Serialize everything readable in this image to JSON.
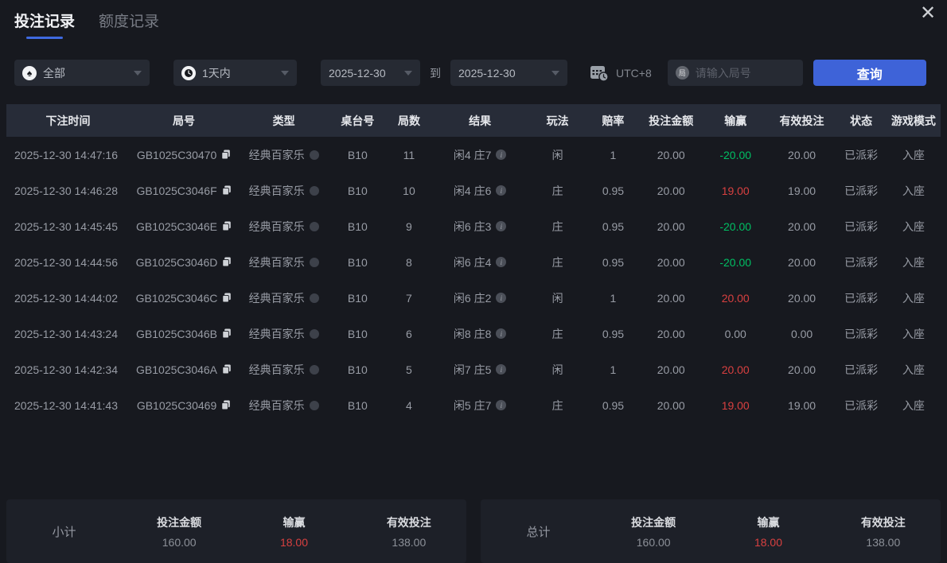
{
  "window": {
    "close_glyph": "✕"
  },
  "tabs": [
    {
      "label": "投注记录",
      "active": true
    },
    {
      "label": "额度记录",
      "active": false
    }
  ],
  "filters": {
    "game_type": {
      "value": "全部",
      "icon": "spade-icon",
      "spade_glyph": "♠"
    },
    "time_range": {
      "value": "1天内",
      "icon": "clock-icon"
    },
    "date_from": "2025-12-30",
    "to_label": "到",
    "date_to": "2025-12-30",
    "timezone": {
      "label": "UTC+8",
      "icon": "calendar-clock-icon"
    },
    "round_input": {
      "placeholder": "请输入局号",
      "badge": "局"
    },
    "query_button": "查询"
  },
  "table": {
    "columns": [
      "下注时间",
      "局号",
      "类型",
      "桌台号",
      "局数",
      "结果",
      "玩法",
      "赔率",
      "投注金额",
      "输赢",
      "有效投注",
      "状态",
      "游戏模式"
    ],
    "rows": [
      {
        "time": "2025-12-30 14:47:16",
        "round_id": "GB1025C30470",
        "type": "经典百家乐",
        "table_no": "B10",
        "round_no": "11",
        "result": "闲4 庄7",
        "play": "闲",
        "odds": "1",
        "bet": "20.00",
        "win_loss": "-20.00",
        "win_loss_color": "green",
        "valid_bet": "20.00",
        "status": "已派彩",
        "mode": "入座"
      },
      {
        "time": "2025-12-30 14:46:28",
        "round_id": "GB1025C3046F",
        "type": "经典百家乐",
        "table_no": "B10",
        "round_no": "10",
        "result": "闲4 庄6",
        "play": "庄",
        "odds": "0.95",
        "bet": "20.00",
        "win_loss": "19.00",
        "win_loss_color": "red",
        "valid_bet": "19.00",
        "status": "已派彩",
        "mode": "入座"
      },
      {
        "time": "2025-12-30 14:45:45",
        "round_id": "GB1025C3046E",
        "type": "经典百家乐",
        "table_no": "B10",
        "round_no": "9",
        "result": "闲6 庄3",
        "play": "庄",
        "odds": "0.95",
        "bet": "20.00",
        "win_loss": "-20.00",
        "win_loss_color": "green",
        "valid_bet": "20.00",
        "status": "已派彩",
        "mode": "入座"
      },
      {
        "time": "2025-12-30 14:44:56",
        "round_id": "GB1025C3046D",
        "type": "经典百家乐",
        "table_no": "B10",
        "round_no": "8",
        "result": "闲6 庄4",
        "play": "庄",
        "odds": "0.95",
        "bet": "20.00",
        "win_loss": "-20.00",
        "win_loss_color": "green",
        "valid_bet": "20.00",
        "status": "已派彩",
        "mode": "入座"
      },
      {
        "time": "2025-12-30 14:44:02",
        "round_id": "GB1025C3046C",
        "type": "经典百家乐",
        "table_no": "B10",
        "round_no": "7",
        "result": "闲6 庄2",
        "play": "闲",
        "odds": "1",
        "bet": "20.00",
        "win_loss": "20.00",
        "win_loss_color": "red",
        "valid_bet": "20.00",
        "status": "已派彩",
        "mode": "入座"
      },
      {
        "time": "2025-12-30 14:43:24",
        "round_id": "GB1025C3046B",
        "type": "经典百家乐",
        "table_no": "B10",
        "round_no": "6",
        "result": "闲8 庄8",
        "play": "庄",
        "odds": "0.95",
        "bet": "20.00",
        "win_loss": "0.00",
        "win_loss_color": "normal",
        "valid_bet": "0.00",
        "status": "已派彩",
        "mode": "入座"
      },
      {
        "time": "2025-12-30 14:42:34",
        "round_id": "GB1025C3046A",
        "type": "经典百家乐",
        "table_no": "B10",
        "round_no": "5",
        "result": "闲7 庄5",
        "play": "闲",
        "odds": "1",
        "bet": "20.00",
        "win_loss": "20.00",
        "win_loss_color": "red",
        "valid_bet": "20.00",
        "status": "已派彩",
        "mode": "入座"
      },
      {
        "time": "2025-12-30 14:41:43",
        "round_id": "GB1025C30469",
        "type": "经典百家乐",
        "table_no": "B10",
        "round_no": "4",
        "result": "闲5 庄7",
        "play": "庄",
        "odds": "0.95",
        "bet": "20.00",
        "win_loss": "19.00",
        "win_loss_color": "red",
        "valid_bet": "19.00",
        "status": "已派彩",
        "mode": "入座"
      }
    ]
  },
  "summary": {
    "subtotal": {
      "label": "小计",
      "stats": [
        {
          "label": "投注金额",
          "value": "160.00",
          "color": "normal"
        },
        {
          "label": "输赢",
          "value": "18.00",
          "color": "red"
        },
        {
          "label": "有效投注",
          "value": "138.00",
          "color": "normal"
        }
      ]
    },
    "total": {
      "label": "总计",
      "stats": [
        {
          "label": "投注金额",
          "value": "160.00",
          "color": "normal"
        },
        {
          "label": "输赢",
          "value": "18.00",
          "color": "red"
        },
        {
          "label": "有效投注",
          "value": "138.00",
          "color": "normal"
        }
      ]
    }
  },
  "colors": {
    "accent_blue": "#3e63d8",
    "positive_red": "#d84040",
    "negative_green": "#00bf63",
    "page_bg": "#17191f",
    "header_bg": "#272c38"
  }
}
